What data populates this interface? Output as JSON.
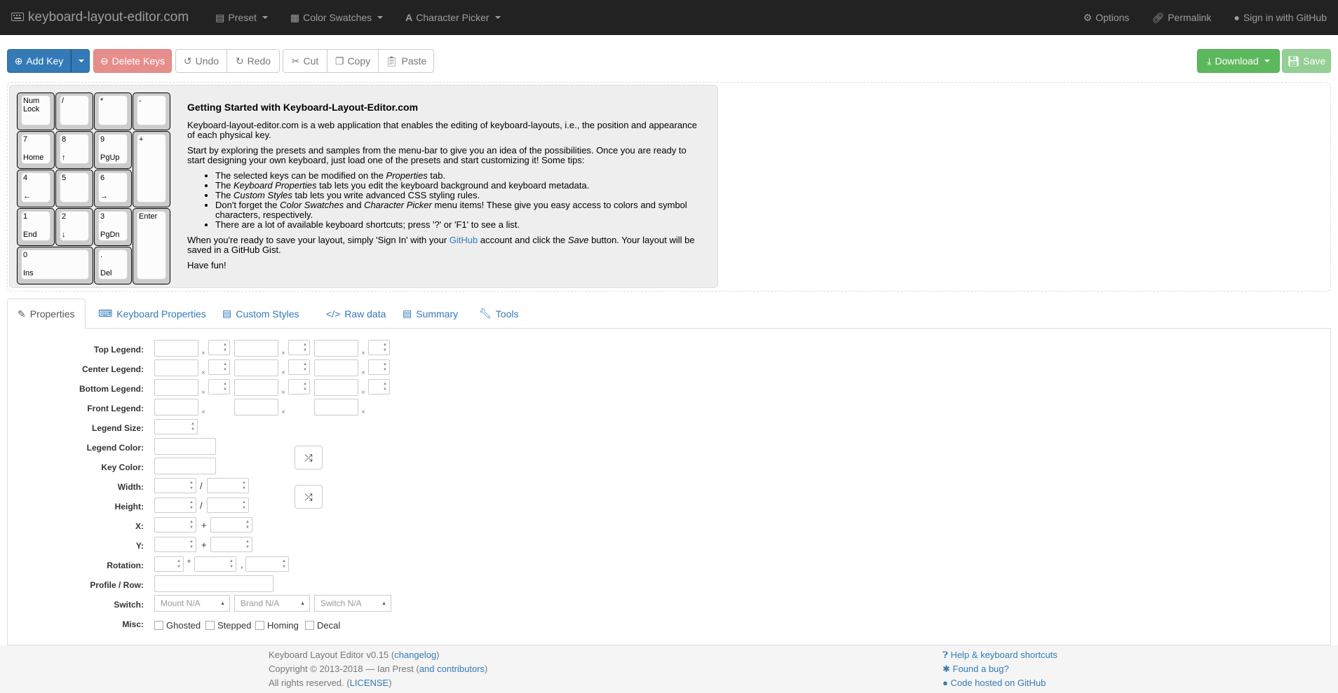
{
  "navbar": {
    "brand": "keyboard-layout-editor.com",
    "preset": "Preset",
    "color_swatches": "Color Swatches",
    "character_picker": "Character Picker",
    "options": "Options",
    "permalink": "Permalink",
    "sign_in": "Sign in with GitHub"
  },
  "toolbar": {
    "add_key": "Add Key",
    "delete_keys": "Delete Keys",
    "undo": "Undo",
    "redo": "Redo",
    "cut": "Cut",
    "copy": "Copy",
    "paste": "Paste",
    "download": "Download",
    "save": "Save"
  },
  "keys": [
    {
      "top": "Num\nLock",
      "bottom": ""
    },
    {
      "top": "/",
      "bottom": ""
    },
    {
      "top": "*",
      "bottom": ""
    },
    {
      "top": "-",
      "bottom": ""
    },
    {
      "top": "7",
      "bottom": "Home"
    },
    {
      "top": "8",
      "bottom": "↑"
    },
    {
      "top": "9",
      "bottom": "PgUp"
    },
    {
      "top": "+",
      "bottom": ""
    },
    {
      "top": "4",
      "bottom": "←"
    },
    {
      "top": "5",
      "bottom": ""
    },
    {
      "top": "6",
      "bottom": "→"
    },
    {
      "top": "1",
      "bottom": "End"
    },
    {
      "top": "2",
      "bottom": "↓"
    },
    {
      "top": "3",
      "bottom": "PgDn"
    },
    {
      "top": "Enter",
      "bottom": ""
    },
    {
      "top": "0",
      "bottom": "Ins"
    },
    {
      "top": ".",
      "bottom": "Del"
    }
  ],
  "getting_started": {
    "title": "Getting Started with Keyboard-Layout-Editor.com",
    "p1": "Keyboard-layout-editor.com is a web application that enables the editing of keyboard-layouts, i.e., the position and appearance of each physical key.",
    "p2": "Start by exploring the presets and samples from the menu-bar to give you an idea of the possibilities. Once you are ready to start designing your own keyboard, just load one of the presets and start customizing it! Some tips:",
    "tips": [
      {
        "a": "The selected keys can be modified on the ",
        "em": "Properties",
        "b": " tab."
      },
      {
        "a": "The ",
        "em": "Keyboard Properties",
        "b": " tab lets you edit the keyboard background and keyboard metadata."
      },
      {
        "a": "The ",
        "em": "Custom Styles",
        "b": " tab lets you write advanced CSS styling rules."
      },
      {
        "a": "Don't forget the ",
        "em": "Color Swatches",
        "b": " and ",
        "em2": "Character Picker",
        "c": " menu items! These give you easy access to colors and symbol characters, respectively."
      },
      {
        "a": "There are a lot of available keyboard shortcuts; press '?' or 'F1' to see a list.",
        "em": "",
        "b": ""
      }
    ],
    "p3a": "When you're ready to save your layout, simply 'Sign In' with your ",
    "p3link": "GitHub",
    "p3b": " account and click the ",
    "p3em": "Save",
    "p3c": " button. Your layout will be saved in a GitHub Gist.",
    "p4": "Have fun!"
  },
  "tabs": [
    "Properties",
    "Keyboard Properties",
    "Custom Styles",
    "Raw data",
    "Summary",
    "Tools"
  ],
  "props": {
    "labels": [
      "Top Legend:",
      "Center Legend:",
      "Bottom Legend:",
      "Front Legend:",
      "Legend Size:",
      "Legend Color:",
      "Key Color:",
      "Width:",
      "Height:",
      "X:",
      "Y:",
      "Rotation:",
      "Profile / Row:",
      "Switch:",
      "Misc:"
    ],
    "x_mark": "×",
    "slash": "/",
    "plus": "+",
    "degree": "°",
    "comma": ",",
    "mount": "Mount N/A",
    "brand": "Brand N/A",
    "switch": "Switch N/A",
    "misc": [
      "Ghosted",
      "Stepped",
      "Homing",
      "Decal"
    ]
  },
  "footer": {
    "line1a": "Keyboard Layout Editor v0.15 (",
    "changelog": "changelog",
    "line1b": ")",
    "line2a": "Copyright © 2013-2018 — Ian Prest (",
    "contributors": "and contributors",
    "line2b": ")",
    "line3a": "All rights reserved. (",
    "license": "LICENSE",
    "line3b": ")",
    "help": "Help & keyboard shortcuts",
    "bug": "Found a bug?",
    "code": "Code hosted on GitHub"
  },
  "colors": {
    "navbar": "#222222",
    "primary": "#337ab7",
    "danger": "#d9534f",
    "success": "#5cb85c"
  }
}
